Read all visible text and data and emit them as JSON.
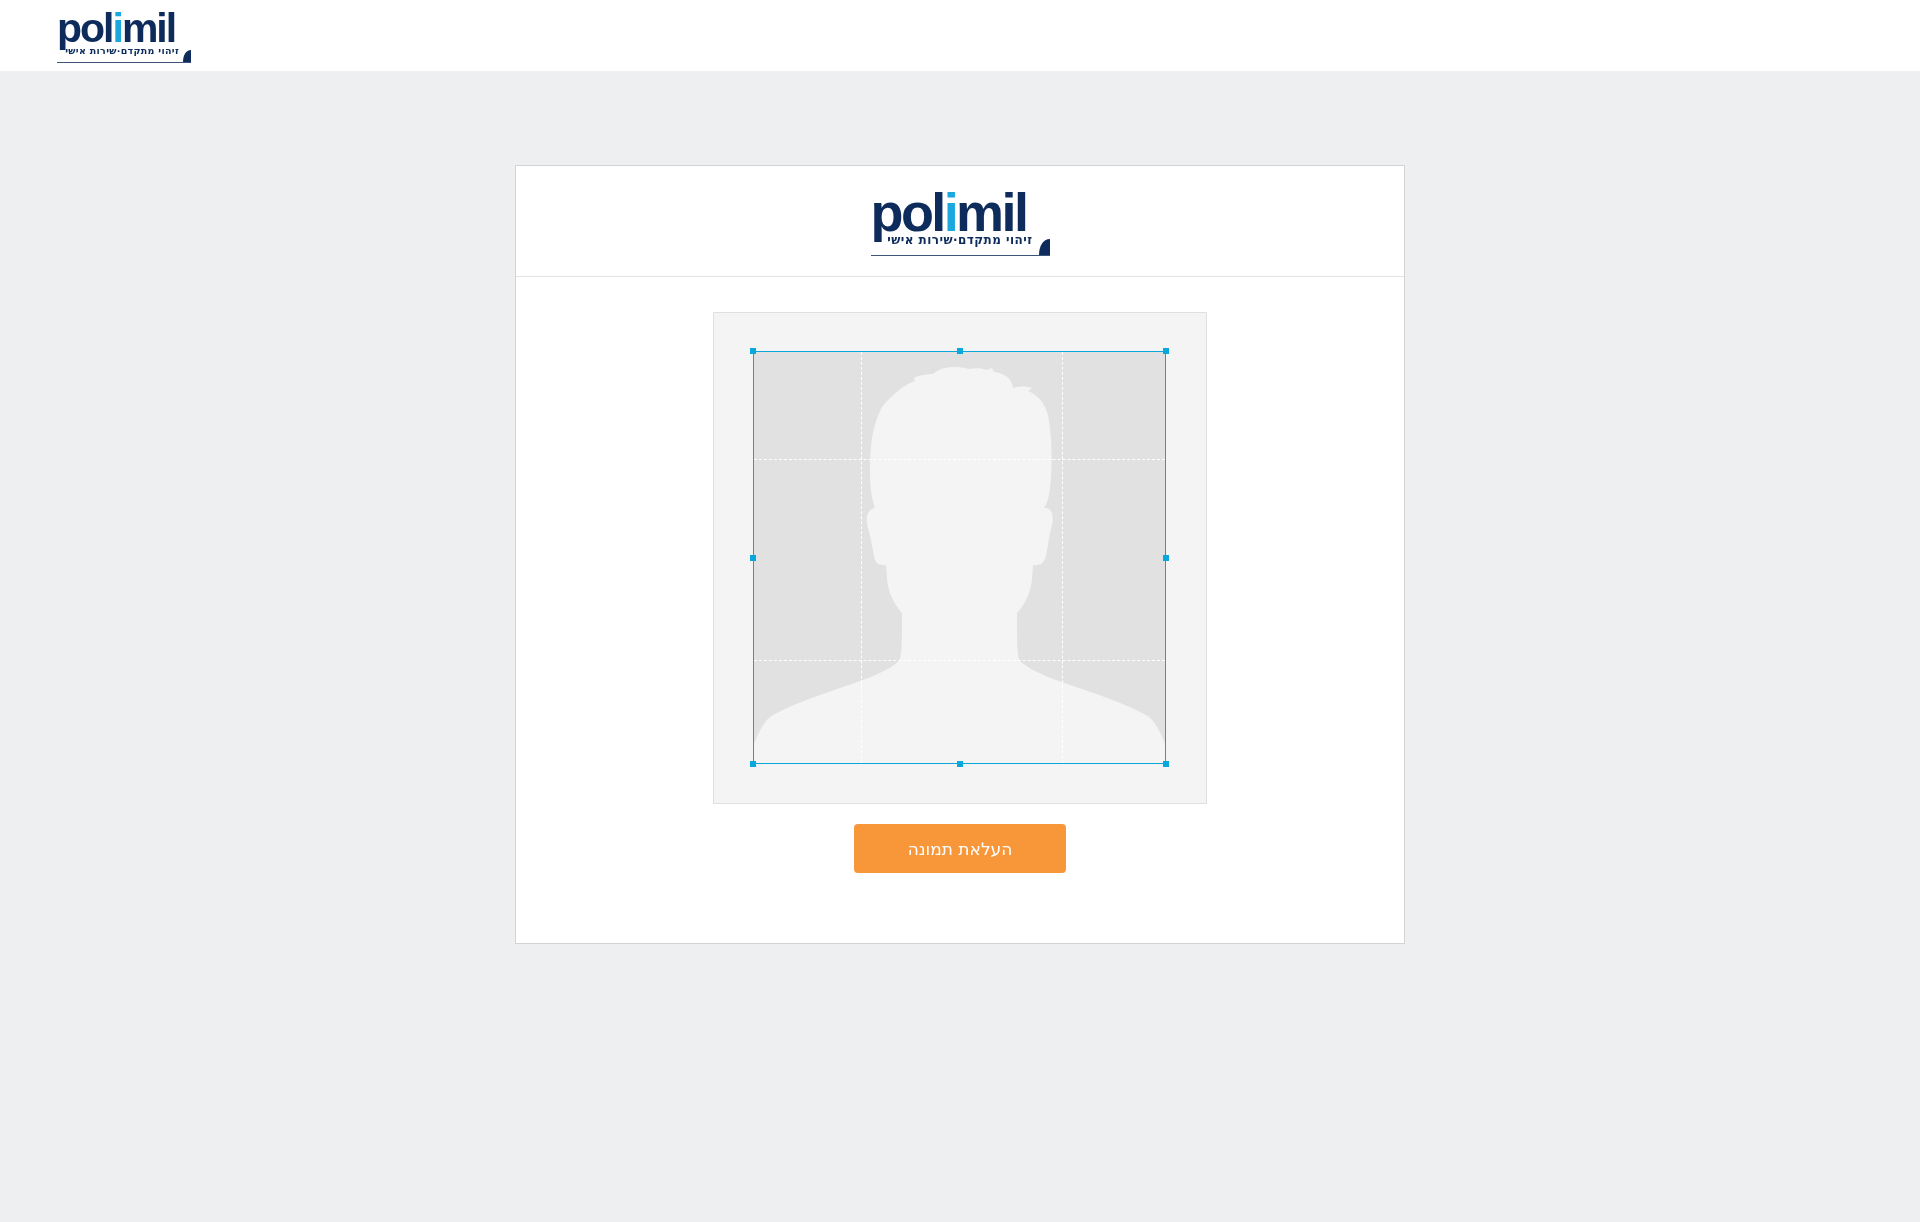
{
  "header": {
    "logo": {
      "wordmark": {
        "lead": "pol",
        "accent": "i",
        "tail": "mil"
      },
      "tagline": "זיהוי מתקדם·שירות אישי"
    }
  },
  "card": {
    "logo": {
      "wordmark": {
        "lead": "pol",
        "accent": "i",
        "tail": "mil"
      },
      "tagline": "זיהוי מתקדם·שירות אישי"
    },
    "upload_button": {
      "label": "העלאת תמונה"
    }
  }
}
